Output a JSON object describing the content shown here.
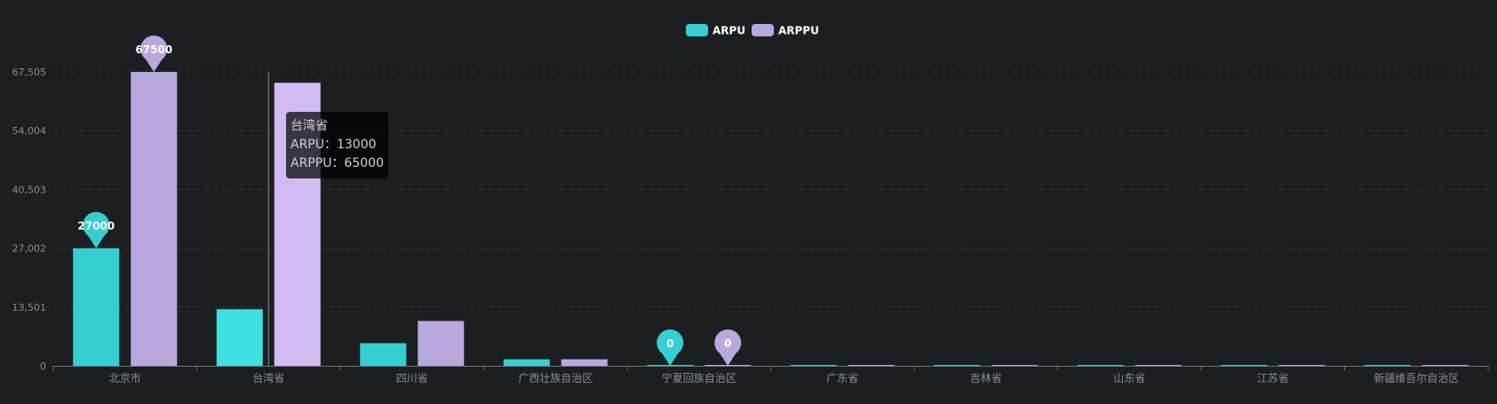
{
  "legend": [
    {
      "name": "ARPU",
      "color": "#36cfd1"
    },
    {
      "name": "ARPPU",
      "color": "#b9a8de"
    }
  ],
  "chart_data": {
    "type": "bar",
    "categories": [
      "北京市",
      "台湾省",
      "四川省",
      "广西壮族自治区",
      "宁夏回族自治区",
      "广东省",
      "吉林省",
      "山东省",
      "江苏省",
      "新疆维吾尔自治区"
    ],
    "series": [
      {
        "name": "ARPU",
        "color": "#36cfd1",
        "values": [
          27000,
          13000,
          5200,
          1500,
          0,
          0,
          0,
          0,
          0,
          0
        ]
      },
      {
        "name": "ARPPU",
        "color": "#b9a8de",
        "values": [
          67500,
          65000,
          10300,
          1500,
          0,
          0,
          0,
          0,
          0,
          0
        ]
      }
    ],
    "y_ticks": [
      "0",
      "13,501",
      "27,002",
      "40,503",
      "54,004",
      "67,505"
    ],
    "ylim": [
      0,
      67505
    ],
    "grid": true,
    "legend_position": "top-center",
    "markers": [
      {
        "series": "ARPU",
        "category": "北京市",
        "label": "27000"
      },
      {
        "series": "ARPPU",
        "category": "北京市",
        "label": "67500"
      },
      {
        "series": "ARPU",
        "category": "宁夏回族自治区",
        "label": "0"
      },
      {
        "series": "ARPPU",
        "category": "宁夏回族自治区",
        "label": "0"
      }
    ],
    "highlight_category": "台湾省"
  },
  "tooltip": {
    "title": "台湾省",
    "line1": "ARPU：13000",
    "line2": "ARPPU：65000"
  }
}
